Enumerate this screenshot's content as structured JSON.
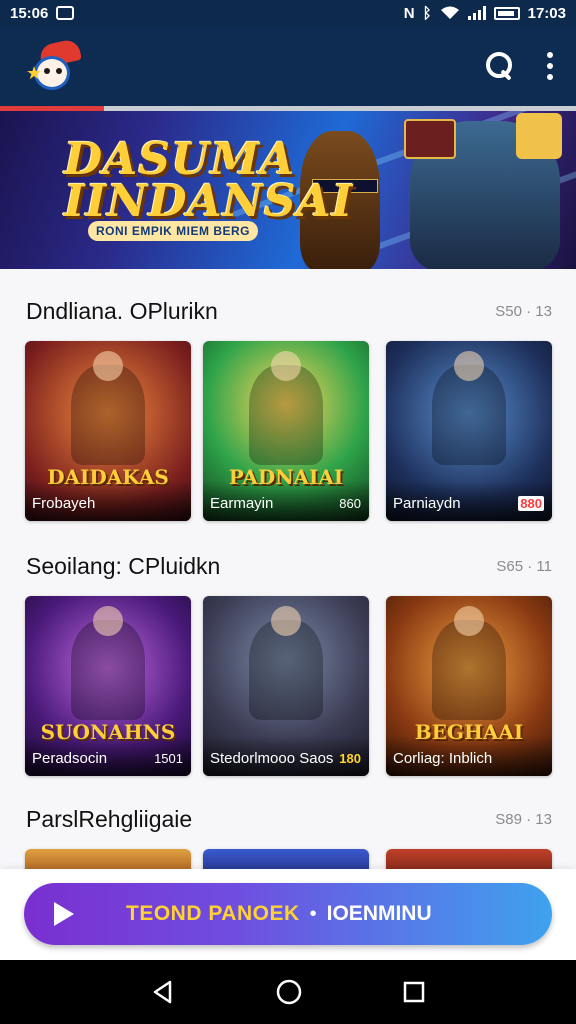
{
  "status_bar": {
    "time": "15:06",
    "right_time": "17:03",
    "icons": [
      "app-icon",
      "nfc-icon",
      "bluetooth-icon",
      "wifi-icon",
      "signal-icon",
      "battery-icon"
    ]
  },
  "app_bar": {
    "logo": "app-logo",
    "actions": [
      "search-icon",
      "more-vert-icon"
    ]
  },
  "loading_progress": 0.18,
  "banner": {
    "title": "DASUMA IINDANSAI",
    "subtitle": "RONI EMPIK MIEM BERG"
  },
  "sections": [
    {
      "title": "Dndliana. OPlurikn",
      "meta": "S50 · 13",
      "cards": [
        {
          "logo": "DAIDAKAS",
          "label": "Frobayeh",
          "count": ""
        },
        {
          "logo": "PADNAIAI",
          "label": "Earmayin",
          "count": "860"
        },
        {
          "logo": "",
          "label": "Parniaydn",
          "count": "880"
        }
      ]
    },
    {
      "title": "Seoilang: CPluidkn",
      "meta": "S65 · 11",
      "cards": [
        {
          "logo": "SUONAHNS",
          "label": "Peradsocin",
          "count": "1501"
        },
        {
          "logo": "",
          "label": "Stedorlmooo Saos",
          "count": "180"
        },
        {
          "logo": "BEGHAAI",
          "label": "Corliag: Inblich",
          "count": ""
        }
      ]
    },
    {
      "title": "ParslRehgliigaie",
      "meta": "S89 · 13",
      "cards": []
    }
  ],
  "cta": {
    "label": "TEOND PANOEK",
    "separator": "•",
    "label2": "IOENMINU"
  },
  "nav_bar": [
    "back-icon",
    "home-icon",
    "recents-icon"
  ],
  "colors": {
    "app_bar": "#0e2c52",
    "accent_red": "#e03c3c",
    "cta_start": "#7a2fd0",
    "cta_end": "#3fa2ee",
    "cta_text": "#ffd233"
  }
}
